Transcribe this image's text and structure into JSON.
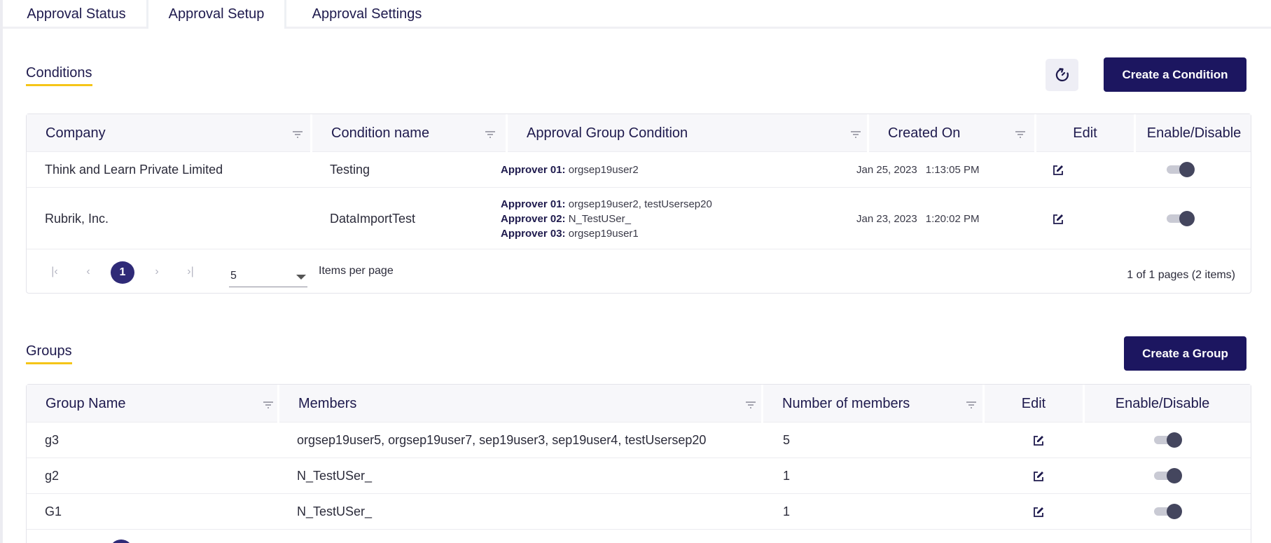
{
  "tabs": [
    {
      "label": "Approval Status"
    },
    {
      "label": "Approval Setup",
      "active": true
    },
    {
      "label": "Approval Settings"
    }
  ],
  "conditions": {
    "title": "Conditions",
    "refresh_icon": "refresh-icon",
    "create_button": "Create a Condition",
    "columns": [
      "Company",
      "Condition name",
      "Approval Group Condition",
      "Created On",
      "Edit",
      "Enable/Disable"
    ],
    "rows": [
      {
        "company": "Think and Learn Private Limited",
        "condition_name": "Testing",
        "approvers": [
          {
            "label": "Approver 01:",
            "value": "orgsep19user2"
          }
        ],
        "created_date": "Jan 25, 2023",
        "created_time": "1:13:05 PM",
        "enabled": true
      },
      {
        "company": "Rubrik, Inc.",
        "condition_name": "DataImportTest",
        "approvers": [
          {
            "label": "Approver 01:",
            "value": "orgsep19user2, testUsersep20"
          },
          {
            "label": "Approver 02:",
            "value": "N_TestUSer_"
          },
          {
            "label": "Approver 03:",
            "value": "orgsep19user1"
          }
        ],
        "created_date": "Jan 23, 2023",
        "created_time": "1:20:02 PM",
        "enabled": true
      }
    ],
    "pagination": {
      "current_page": "1",
      "page_size": "5",
      "items_per_page_label": "Items per page",
      "info": "1 of 1 pages (2 items)"
    }
  },
  "groups": {
    "title": "Groups",
    "create_button": "Create a Group",
    "columns": [
      "Group Name",
      "Members",
      "Number of members",
      "Edit",
      "Enable/Disable"
    ],
    "rows": [
      {
        "name": "g3",
        "members": "orgsep19user5, orgsep19user7, sep19user3, sep19user4, testUsersep20",
        "count": "5",
        "enabled": true
      },
      {
        "name": "g2",
        "members": "N_TestUSer_",
        "count": "1",
        "enabled": true
      },
      {
        "name": "G1",
        "members": "N_TestUSer_",
        "count": "1",
        "enabled": true
      }
    ]
  },
  "colors": {
    "primary": "#1c1660",
    "accent_underline": "#f5c518",
    "page_active": "#2f2a77"
  }
}
